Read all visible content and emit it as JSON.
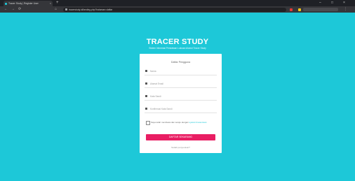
{
  "browser": {
    "tab_title": "Tracer Study | Register User",
    "tab_close": "×",
    "new_tab": "+",
    "url": "tracerstudy.id/landing.php?halaman=daftar",
    "nav_back": "←",
    "nav_forward": "→",
    "nav_reload": "⟳",
    "nav_home": "⌂",
    "minimize": "–",
    "maximize": "□",
    "close": "×",
    "menu": "⋮"
  },
  "hero": {
    "title": "TRACER STUDY",
    "subtitle": "Sistem Informasi Pendataan Lulusan Alumni Tracer Study"
  },
  "form": {
    "title": "Daftar Pengguna",
    "fields": [
      {
        "icon": "user-icon",
        "placeholder": "Nama"
      },
      {
        "icon": "email-icon",
        "placeholder": "Alamat Email"
      },
      {
        "icon": "lock-icon",
        "placeholder": "Kata Sandi"
      },
      {
        "icon": "lock-icon",
        "placeholder": "Konfirmasi Kata Sandi"
      }
    ],
    "agree_text": "Saya telah membaca dan setuju dengan",
    "agree_link": "syarat & ketentuan",
    "register_label": "DAFTAR SEKARANG",
    "login_label": "Sudah punya akun?"
  }
}
